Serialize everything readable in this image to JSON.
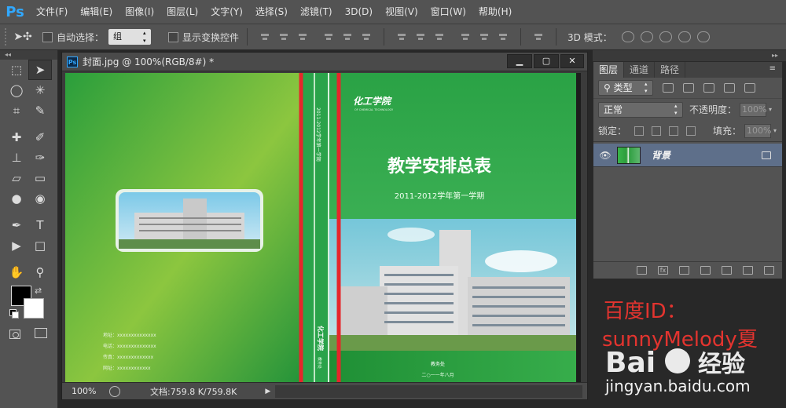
{
  "app": {
    "logo": "Ps",
    "menu": [
      "文件(F)",
      "编辑(E)",
      "图像(I)",
      "图层(L)",
      "文字(Y)",
      "选择(S)",
      "滤镜(T)",
      "3D(D)",
      "视图(V)",
      "窗口(W)",
      "帮助(H)"
    ]
  },
  "options": {
    "move_tool_icon": "move-arrow-icon",
    "auto_select_label": "自动选择：",
    "auto_select_value": "组",
    "show_transform_label": "显示变换控件",
    "mode_3d_label": "3D 模式："
  },
  "document": {
    "title": "封面.jpg @ 100%(RGB/8#) *",
    "tab_icon": "Ps",
    "minimize": "▁",
    "restore": "▢",
    "close": "✕",
    "zoom": "100%",
    "doc_size": "文档:759.8 K/759.8K",
    "status_arrow": "▶"
  },
  "cover": {
    "logo_text": "化工学院",
    "logo_sub": "OF CHEMICAL TECHNOLOGY",
    "title": "教学安排总表",
    "subtitle": "2011-2012学年第一学期",
    "spine_text": "2011-2012学年第一学期",
    "spine_logo": "化工学院",
    "spine_bottom": "教务处",
    "dept": "教务处",
    "date": "二○一一年八月",
    "info_lines": [
      "地址：xxxxxxxxxxxxxx",
      "电话：xxxxxxxxxxxxxx",
      "传真：xxxxxxxxxxxxx",
      "网址：xxxxxxxxxxxx"
    ],
    "highlight_color": "#e6262b"
  },
  "layers_panel": {
    "tabs": [
      "图层",
      "通道",
      "路径"
    ],
    "menu_icon": "≡",
    "filter_kind": "类型",
    "blend_mode": "正常",
    "opacity_label": "不透明度：",
    "opacity_value": "100%",
    "lock_label": "锁定：",
    "fill_label": "填充：",
    "fill_value": "100%",
    "layer_name": "背景",
    "footer_icons": [
      "link-icon",
      "fx-icon",
      "mask-icon",
      "adjustment-icon",
      "folder-icon",
      "new-layer-icon",
      "trash-icon"
    ]
  },
  "watermark": {
    "id_line": "百度ID：",
    "user_line": "sunnyMelody夏",
    "logo": "Bai百度经验",
    "url": "jingyan.baidu.com"
  },
  "colors": {
    "ui_bg": "#535353",
    "ps_blue": "#31a8ff",
    "cover_green": "#2fa844",
    "watermark_red": "#e3342f"
  }
}
